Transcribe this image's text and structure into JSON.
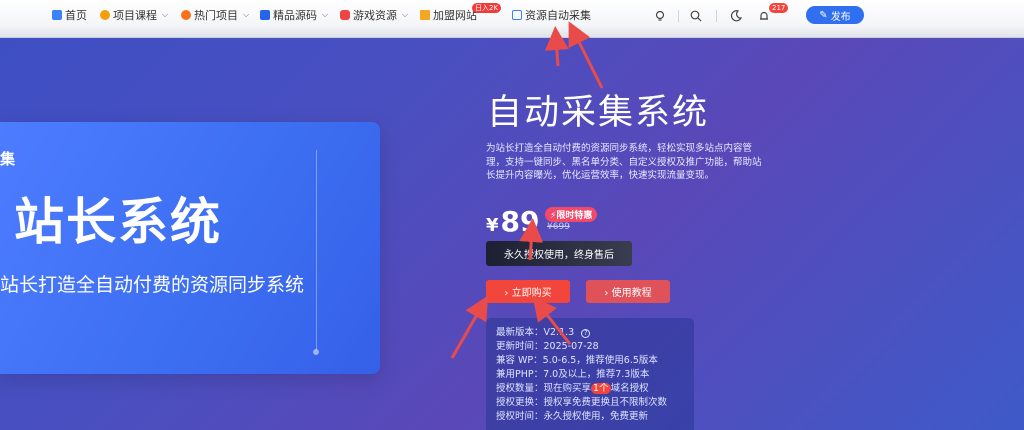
{
  "nav": {
    "items": [
      {
        "label": "首页",
        "icon": "home-icon",
        "color": "#3b82f6",
        "dropdown": false
      },
      {
        "label": "项目课程",
        "icon": "course-icon",
        "color": "#f59e0b",
        "dropdown": true
      },
      {
        "label": "热门项目",
        "icon": "fire-icon",
        "color": "#f97316",
        "dropdown": true
      },
      {
        "label": "精品源码",
        "icon": "code-icon",
        "color": "#2563eb",
        "dropdown": true
      },
      {
        "label": "游戏资源",
        "icon": "game-icon",
        "color": "#ef4444",
        "dropdown": true
      },
      {
        "label": "加盟网站",
        "icon": "crown-icon",
        "color": "#f5a623",
        "dropdown": false
      },
      {
        "label": "资源自动采集",
        "icon": "box-icon",
        "color": "#3b82f6",
        "dropdown": false
      }
    ],
    "new_badge": "日入2K",
    "bell_count": "217",
    "publish_label": "发布"
  },
  "banner": {
    "fragment": "集",
    "big_text": "站长系统",
    "subtitle": "站长打造全自动付费的资源同步系统"
  },
  "product": {
    "title": "自动采集系统",
    "description": "为站长打造全自动付费的资源同步系统，轻松实现多站点内容管理，支持一键同步、黑名单分类、自定义授权及推广功能，帮助站长提升内容曝光，优化运营效率，快速实现流量变现。",
    "currency": "¥",
    "price": "89",
    "limit_tag": "限时特惠",
    "old_price": "¥699",
    "lifetime_note": "永久授权使用，终身售后",
    "buy_label": "› 立即购买",
    "guide_label": "› 使用教程"
  },
  "info": {
    "version_label": "最新版本：",
    "version_value": "V2.1.3",
    "updated_label": "更新时间：",
    "updated_value": "2025-07-28",
    "wp_label": "兼容 WP：",
    "wp_value": "5.0-6.5，推荐使用6.5版本",
    "php_label": "兼用PHP：",
    "php_value": "7.0及以上，推荐7.3版本",
    "count_label": "授权数量：",
    "count_before": "现在购买享",
    "count_highlight": "1个",
    "count_after": "域名授权",
    "change_label": "授权更换：",
    "change_value": "授权享免费更换且不限制次数",
    "time_label": "授权时间：",
    "time_value": "永久授权使用，免费更新"
  }
}
